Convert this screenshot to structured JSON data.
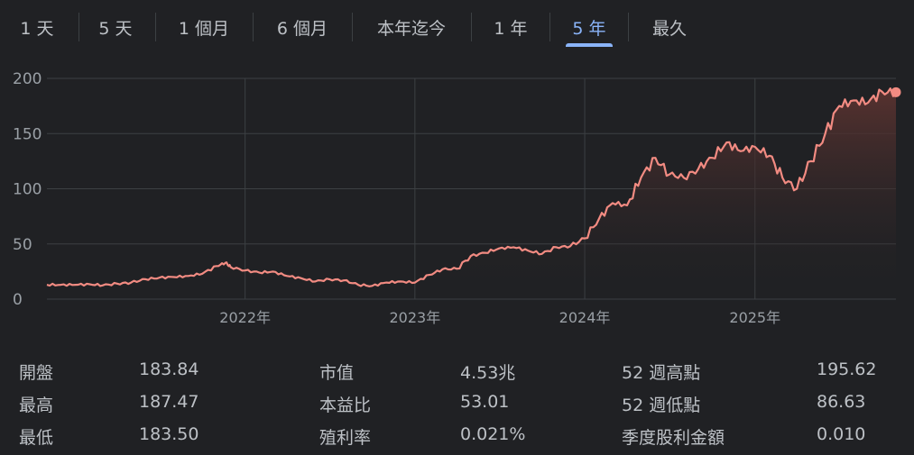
{
  "tabs": [
    {
      "label": "1 天",
      "active": false
    },
    {
      "label": "5 天",
      "active": false
    },
    {
      "label": "1 個月",
      "active": false
    },
    {
      "label": "6 個月",
      "active": false
    },
    {
      "label": "本年迄今",
      "active": false
    },
    {
      "label": "1 年",
      "active": false
    },
    {
      "label": "5 年",
      "active": true
    },
    {
      "label": "最久",
      "active": false
    }
  ],
  "chart_data": {
    "type": "area",
    "y_ticks": [
      "0",
      "50",
      "100",
      "150",
      "200"
    ],
    "ylim": [
      0,
      200
    ],
    "x_ticks": [
      {
        "label": "2022年",
        "date": "2022-01-01"
      },
      {
        "label": "2023年",
        "date": "2023-01-01"
      },
      {
        "label": "2024年",
        "date": "2024-01-01"
      },
      {
        "label": "2025年",
        "date": "2025-01-01"
      }
    ],
    "xlim": [
      "2020-11-01",
      "2025-10-31"
    ],
    "grid": true,
    "colors": {
      "line": "#f28b82",
      "fill_top": "#5b3330",
      "grid": "#3c4043"
    },
    "points": [
      [
        "2020-11-01",
        13
      ],
      [
        "2020-12-01",
        13
      ],
      [
        "2021-01-01",
        13
      ],
      [
        "2021-02-01",
        13.5
      ],
      [
        "2021-03-01",
        12.5
      ],
      [
        "2021-04-01",
        14
      ],
      [
        "2021-05-01",
        15
      ],
      [
        "2021-06-01",
        18
      ],
      [
        "2021-07-01",
        19.5
      ],
      [
        "2021-08-01",
        20
      ],
      [
        "2021-09-01",
        21
      ],
      [
        "2021-10-01",
        23
      ],
      [
        "2021-11-01",
        30
      ],
      [
        "2021-11-20",
        33
      ],
      [
        "2021-12-01",
        29
      ],
      [
        "2022-01-01",
        26
      ],
      [
        "2022-02-01",
        24
      ],
      [
        "2022-03-01",
        25
      ],
      [
        "2022-04-01",
        21
      ],
      [
        "2022-05-01",
        19
      ],
      [
        "2022-06-01",
        16
      ],
      [
        "2022-07-01",
        18
      ],
      [
        "2022-08-01",
        17
      ],
      [
        "2022-09-01",
        13
      ],
      [
        "2022-10-01",
        12
      ],
      [
        "2022-11-01",
        15
      ],
      [
        "2022-12-01",
        16
      ],
      [
        "2023-01-01",
        15
      ],
      [
        "2023-02-01",
        22
      ],
      [
        "2023-03-01",
        27
      ],
      [
        "2023-04-01",
        27.5
      ],
      [
        "2023-05-01",
        39
      ],
      [
        "2023-06-01",
        42
      ],
      [
        "2023-07-01",
        46
      ],
      [
        "2023-08-01",
        47
      ],
      [
        "2023-09-01",
        44
      ],
      [
        "2023-10-01",
        41
      ],
      [
        "2023-11-01",
        47
      ],
      [
        "2023-12-01",
        48
      ],
      [
        "2024-01-01",
        55
      ],
      [
        "2024-02-01",
        73
      ],
      [
        "2024-03-01",
        87
      ],
      [
        "2024-04-01",
        85
      ],
      [
        "2024-05-01",
        110
      ],
      [
        "2024-06-01",
        128
      ],
      [
        "2024-07-01",
        113
      ],
      [
        "2024-08-01",
        110
      ],
      [
        "2024-09-01",
        118
      ],
      [
        "2024-10-01",
        128
      ],
      [
        "2024-11-01",
        142
      ],
      [
        "2024-12-01",
        134
      ],
      [
        "2025-01-01",
        138
      ],
      [
        "2025-02-01",
        130
      ],
      [
        "2025-03-01",
        110
      ],
      [
        "2025-04-01",
        100
      ],
      [
        "2025-05-01",
        125
      ],
      [
        "2025-06-01",
        150
      ],
      [
        "2025-07-01",
        175
      ],
      [
        "2025-08-01",
        180
      ],
      [
        "2025-09-01",
        178
      ],
      [
        "2025-10-01",
        188
      ],
      [
        "2025-10-31",
        187.5
      ]
    ]
  },
  "stats": [
    {
      "label": "開盤",
      "value": "183.84"
    },
    {
      "label": "最高",
      "value": "187.47"
    },
    {
      "label": "最低",
      "value": "183.50"
    },
    {
      "label": "市值",
      "value": "4.53兆"
    },
    {
      "label": "本益比",
      "value": "53.01"
    },
    {
      "label": "殖利率",
      "value": "0.021%"
    },
    {
      "label": "52 週高點",
      "value": "195.62"
    },
    {
      "label": "52 週低點",
      "value": "86.63"
    },
    {
      "label": "季度股利金額",
      "value": "0.010"
    }
  ]
}
